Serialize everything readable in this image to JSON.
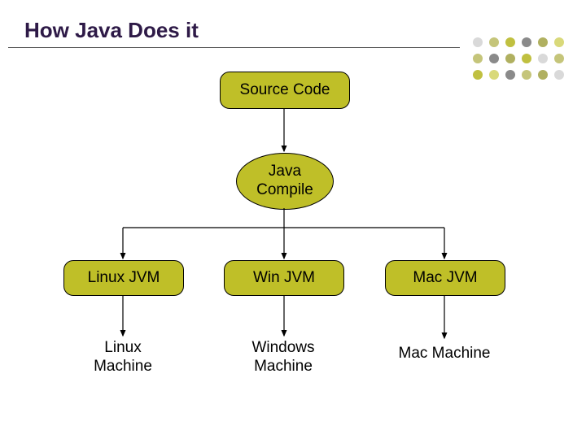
{
  "title": "How Java Does it",
  "nodes": {
    "source": "Source Code",
    "compile": "Java\nCompile",
    "linux_jvm": "Linux JVM",
    "win_jvm": "Win JVM",
    "mac_jvm": "Mac JVM",
    "linux_machine": "Linux\nMachine",
    "windows_machine": "Windows\nMachine",
    "mac_machine": "Mac Machine"
  },
  "colors": {
    "node_fill": "#bfbf28",
    "title_color": "#2e1a47"
  }
}
